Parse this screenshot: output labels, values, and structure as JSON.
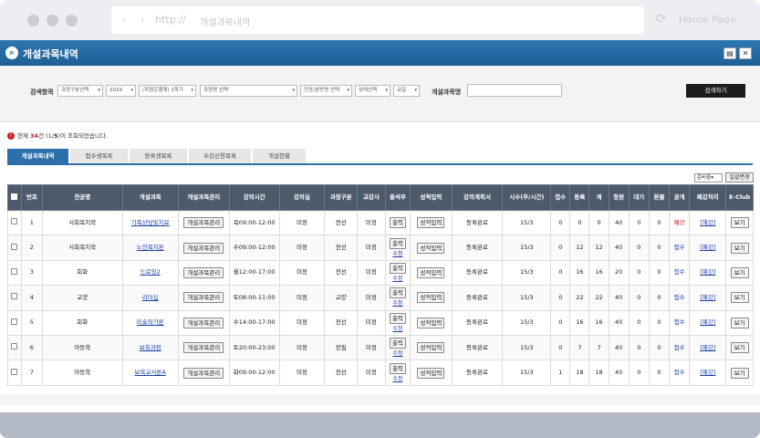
{
  "browser": {
    "protocol": "http://",
    "url": "개설과목내역",
    "home_label": "Home Page",
    "nav_arrows": "‹ ›"
  },
  "header": {
    "title": "개설과목내역",
    "print_icon": "printer-icon",
    "excel_icon": "excel-icon"
  },
  "search": {
    "label": "검색항목",
    "filters": [
      "과정구분선택",
      "2019",
      "(학점은행제) 1학기",
      "과정명 선택",
      "전공/분반명 선택",
      "상태선택",
      "요일"
    ],
    "course_label": "개설과목명",
    "course_value": "",
    "button": "검색하기"
  },
  "summary": {
    "prefix": "현재 ",
    "count": "34",
    "middle": "건 (1/",
    "pages": "5",
    "suffix": ")이 조회되었습니다."
  },
  "tabs": [
    "개설과목내역",
    "접수생목록",
    "등록생목록",
    "수강신청목록",
    "개설현황"
  ],
  "toolbar": {
    "status_select": "준비중",
    "apply_button": "일괄변경"
  },
  "table": {
    "headers": [
      "번호",
      "전공명",
      "개설과목",
      "개설과목관리",
      "강의시간",
      "강의실",
      "과정구분",
      "교강사",
      "출석부",
      "성적입력",
      "강의계획서",
      "시수(주/시간)",
      "접수",
      "등록",
      "계",
      "정원",
      "대기",
      "환불",
      "공개",
      "폐강처리",
      "E-Club"
    ],
    "rows": [
      {
        "no": "1",
        "major": "사회복지학",
        "course": "가족상담및치료",
        "manage": "개설과목관리",
        "time": "목09:00-12:00",
        "room": "미정",
        "type": "전선",
        "teacher": "미정",
        "attend": "출력",
        "attend_sub": "",
        "grade": "성적입력",
        "plan": "등록완료",
        "hours": "15/3",
        "apply": "0",
        "reg": "0",
        "total": "0",
        "cap": "40",
        "wait": "0",
        "refund": "0",
        "open": "폐강",
        "close": "[해강]",
        "club": "보기"
      },
      {
        "no": "2",
        "major": "사회복지학",
        "course": "노인복지론",
        "manage": "개설과목관리",
        "time": "수09:00-12:00",
        "room": "미정",
        "type": "전선",
        "teacher": "미정",
        "attend": "출력",
        "attend_sub": "수정",
        "grade": "성적입력",
        "plan": "등록완료",
        "hours": "15/3",
        "apply": "0",
        "reg": "12",
        "total": "12",
        "cap": "40",
        "wait": "0",
        "refund": "0",
        "open": "접수",
        "close": "[폐강]",
        "club": "보기"
      },
      {
        "no": "3",
        "major": "회화",
        "course": "드로잉2",
        "manage": "개설과목관리",
        "time": "월12:00-17:00",
        "room": "미정",
        "type": "전선",
        "teacher": "미정",
        "attend": "출력",
        "attend_sub": "수정",
        "grade": "성적입력",
        "plan": "등록완료",
        "hours": "15/3",
        "apply": "0",
        "reg": "16",
        "total": "16",
        "cap": "20",
        "wait": "0",
        "refund": "0",
        "open": "접수",
        "close": "[폐강]",
        "club": "보기"
      },
      {
        "no": "4",
        "major": "교양",
        "course": "리더십",
        "manage": "개설과목관리",
        "time": "토08:00-11:00",
        "room": "미정",
        "type": "교양",
        "teacher": "미정",
        "attend": "출력",
        "attend_sub": "수정",
        "grade": "성적입력",
        "plan": "등록완료",
        "hours": "15/3",
        "apply": "0",
        "reg": "22",
        "total": "22",
        "cap": "40",
        "wait": "0",
        "refund": "0",
        "open": "접수",
        "close": "[폐강]",
        "club": "보기"
      },
      {
        "no": "5",
        "major": "회화",
        "course": "미술작가론",
        "manage": "개설과목관리",
        "time": "수14:00-17:00",
        "room": "미정",
        "type": "전선",
        "teacher": "미정",
        "attend": "출력",
        "attend_sub": "수정",
        "grade": "성적입력",
        "plan": "등록완료",
        "hours": "15/3",
        "apply": "0",
        "reg": "16",
        "total": "16",
        "cap": "40",
        "wait": "0",
        "refund": "0",
        "open": "접수",
        "close": "[폐강]",
        "club": "보기"
      },
      {
        "no": "6",
        "major": "아동학",
        "course": "보육과정",
        "manage": "개설과목관리",
        "time": "토20:00-23:00",
        "room": "미정",
        "type": "전필",
        "teacher": "미정",
        "attend": "출력",
        "attend_sub": "수정",
        "grade": "성적입력",
        "plan": "등록완료",
        "hours": "15/3",
        "apply": "0",
        "reg": "7",
        "total": "7",
        "cap": "40",
        "wait": "0",
        "refund": "0",
        "open": "접수",
        "close": "[폐강]",
        "club": "보기"
      },
      {
        "no": "7",
        "major": "아동학",
        "course": "보육교사론A",
        "manage": "개설과목관리",
        "time": "화09:00-12:00",
        "room": "미정",
        "type": "전선",
        "teacher": "미정",
        "attend": "출력",
        "attend_sub": "수정",
        "grade": "성적입력",
        "plan": "등록완료",
        "hours": "15/3",
        "apply": "1",
        "reg": "18",
        "total": "18",
        "cap": "40",
        "wait": "0",
        "refund": "0",
        "open": "접수",
        "close": "[폐강]",
        "club": "보기"
      }
    ]
  },
  "colors": {
    "header_blue": "#2d77b2",
    "table_header": "#4d5a6c",
    "accent_red": "#d01010",
    "link_blue": "#1a3fa8"
  }
}
